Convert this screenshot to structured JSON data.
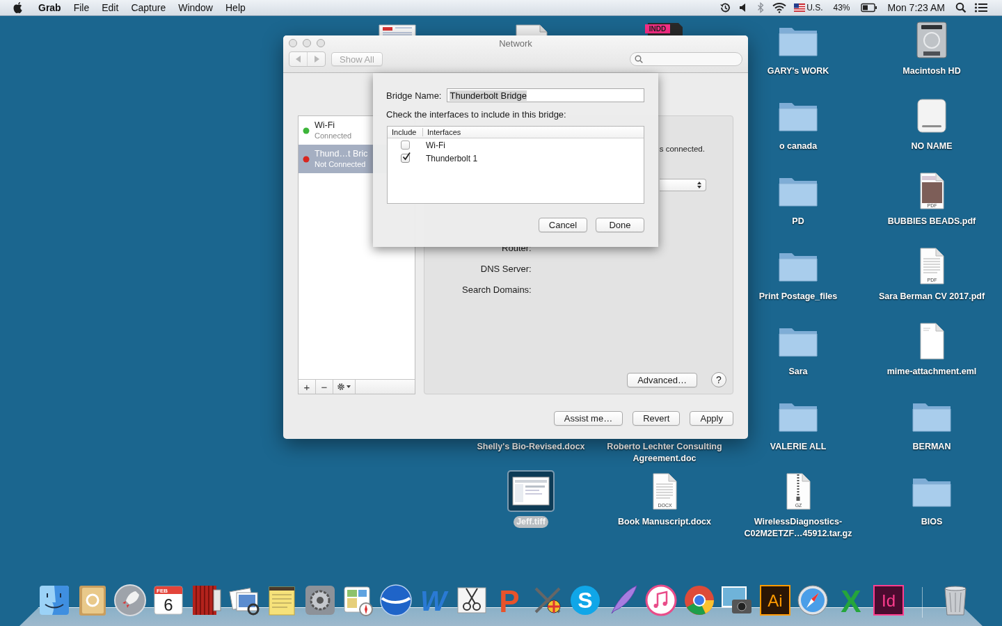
{
  "menu_bar": {
    "app": "Grab",
    "menus": [
      "File",
      "Edit",
      "Capture",
      "Window",
      "Help"
    ],
    "input_source": "U.S.",
    "battery": "43%",
    "clock": "Mon 7:23 AM"
  },
  "covered_icons": [
    {
      "kind": "document"
    },
    {
      "kind": "plaindoc"
    },
    {
      "kind": "indd",
      "badge": "INDD"
    }
  ],
  "desktop_icons": [
    {
      "kind": "folder",
      "label": "GARY's WORK",
      "selected": false
    },
    {
      "kind": "harddisk",
      "label": "Macintosh HD",
      "selected": false
    },
    {
      "kind": "folder",
      "label": "o canada",
      "selected": false
    },
    {
      "kind": "drive",
      "label": "NO NAME",
      "selected": false
    },
    {
      "kind": "folder",
      "label": "PD",
      "selected": false
    },
    {
      "kind": "pdfphoto",
      "label": "BUBBIES BEADS.pdf",
      "badge": "PDF",
      "selected": false
    },
    {
      "kind": "folder",
      "label": "Print Postage_files",
      "selected": false
    },
    {
      "kind": "pdf",
      "label": "Sara Berman CV 2017.pdf",
      "badge": "PDF",
      "selected": false
    },
    {
      "kind": "folder",
      "label": "Sara",
      "selected": false
    },
    {
      "kind": "blank",
      "label": "mime-attachment.eml",
      "selected": false
    },
    {
      "kind": "labelonly",
      "label": "Shelly's Bio-Revised.docx",
      "selected": false
    },
    {
      "kind": "labelonly",
      "label": "Roberto Lechter Consulting Agreement.doc",
      "selected": false
    },
    {
      "kind": "folder",
      "label": "VALERIE ALL",
      "selected": false
    },
    {
      "kind": "folder",
      "label": "BERMAN",
      "selected": false
    },
    {
      "kind": "image",
      "label": "Jeff.tiff",
      "selected": true
    },
    {
      "kind": "docx",
      "label": "Book Manuscript.docx",
      "badge": "DOCX",
      "selected": false
    },
    {
      "kind": "gz",
      "label": "WirelessDiagnostics-C02M2ETZF…45912.tar.gz",
      "badge": "GZ",
      "selected": false
    },
    {
      "kind": "folder",
      "label": "BIOS",
      "selected": false
    }
  ],
  "window": {
    "title": "Network",
    "show_all": "Show All",
    "services": [
      {
        "name": "Wi-Fi",
        "status": "Connected",
        "color": "#3db53a",
        "selected": false
      },
      {
        "name": "Thund…t Bric",
        "status": "Not Connected",
        "color": "#d8261f",
        "selected": true
      }
    ],
    "list_tools": [
      "+",
      "−"
    ],
    "status_text": "s connected.",
    "fields": [
      "Router:",
      "DNS Server:",
      "Search Domains:"
    ],
    "advanced": "Advanced…",
    "help": "?",
    "buttons": [
      "Assist me…",
      "Revert",
      "Apply"
    ]
  },
  "sheet": {
    "bridge_label": "Bridge Name:",
    "bridge_name": "Thunderbolt Bridge",
    "prompt": "Check the interfaces to include in this bridge:",
    "columns": [
      "Include",
      "Interfaces"
    ],
    "interfaces": [
      {
        "name": "Wi-Fi",
        "checked": false
      },
      {
        "name": "Thunderbolt 1",
        "checked": true
      }
    ],
    "buttons": [
      "Cancel",
      "Done"
    ]
  },
  "dock": [
    {
      "kind": "finder"
    },
    {
      "kind": "contacts"
    },
    {
      "kind": "launchpad"
    },
    {
      "kind": "calendar",
      "month": "FEB",
      "day": "6"
    },
    {
      "kind": "photobooth"
    },
    {
      "kind": "preview"
    },
    {
      "kind": "stickies"
    },
    {
      "kind": "sysprefs"
    },
    {
      "kind": "dashboard"
    },
    {
      "kind": "earth"
    },
    {
      "kind": "word",
      "text": "W"
    },
    {
      "kind": "scissors"
    },
    {
      "kind": "powerpoint",
      "text": "P"
    },
    {
      "kind": "tools"
    },
    {
      "kind": "skype",
      "text": "S"
    },
    {
      "kind": "quill"
    },
    {
      "kind": "music"
    },
    {
      "kind": "chrome"
    },
    {
      "kind": "camera"
    },
    {
      "kind": "illustrator",
      "text": "Ai"
    },
    {
      "kind": "safari"
    },
    {
      "kind": "excel",
      "text": "X"
    },
    {
      "kind": "indesign",
      "text": "Id"
    },
    {
      "kind": "trash"
    }
  ]
}
